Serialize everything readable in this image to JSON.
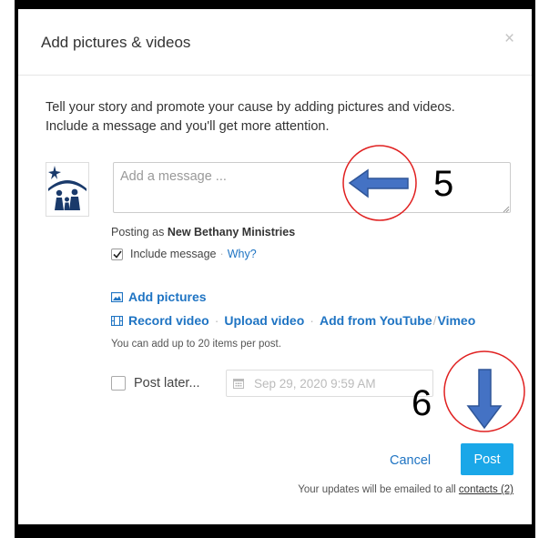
{
  "dialog": {
    "title": "Add pictures & videos",
    "close_glyph": "×",
    "intro": "Tell your story and promote your cause by adding pictures and videos. Include a message and you'll get more attention.",
    "message_placeholder": "Add a message ...",
    "posting_as_prefix": "Posting as ",
    "posting_as_name": "New Bethany Ministries",
    "include_message": {
      "label": "Include message",
      "checked": true
    },
    "why_link": "Why?",
    "add_pictures": "Add pictures",
    "record_video": "Record video",
    "upload_video": "Upload video",
    "add_from_youtube": "Add from YouTube",
    "slash": "/",
    "vimeo": "Vimeo",
    "limit_note": "You can add up to 20 items per post.",
    "post_later": {
      "label": "Post later...",
      "checked": false
    },
    "date_value": "Sep 29, 2020 9:59 AM",
    "cancel_label": "Cancel",
    "post_label": "Post",
    "footer_prefix": "Your updates will be emailed to all ",
    "footer_link": "contacts (2)"
  },
  "annotations": {
    "step_a": "5",
    "step_b": "6"
  },
  "colors": {
    "link": "#1f74c3",
    "post_button": "#1aa7e8",
    "annotation_circle": "#e02020",
    "annotation_arrow": "#4472c4"
  },
  "icons": [
    "close-icon",
    "organization-logo",
    "checkmark-icon",
    "image-icon",
    "film-icon",
    "calendar-icon",
    "resize-grip-icon"
  ]
}
